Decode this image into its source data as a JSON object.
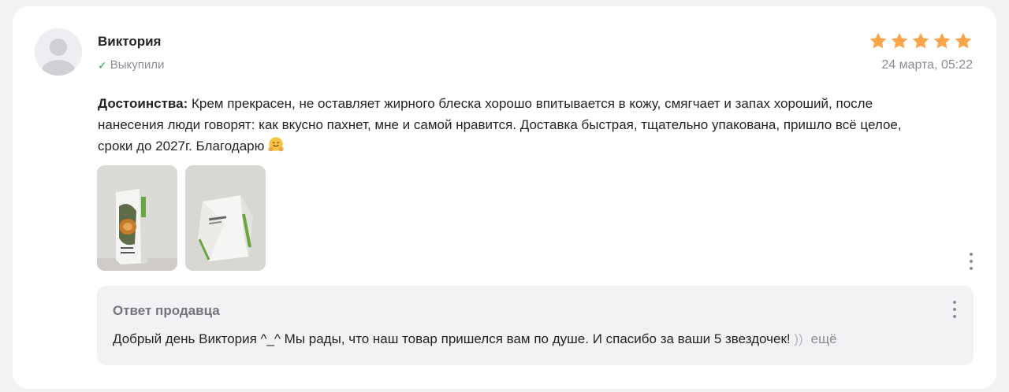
{
  "review": {
    "author": "Виктория",
    "verified_label": "Выкупили",
    "verified_icon": "check-icon",
    "rating": 5,
    "rating_max": 5,
    "star_color": "#f9a64a",
    "date": "24 марта, 05:22",
    "pros_label": "Достоинства:",
    "pros_text": " Крем прекрасен, не оставляет жирного блеска хорошо впитывается в кожу, смягчает и запах хороший, после нанесения люди говорят: как вкусно пахнет, мне и самой нравится. Доставка быстрая, тщательно упакована, пришло всё целое, сроки до 2027г. Благодарю",
    "emoji": "hugging-face-emoji",
    "photos": [
      "product-box-photo",
      "product-box-bottom-photo"
    ],
    "more_icon": "more-vertical-icon"
  },
  "seller_reply": {
    "title": "Ответ продавца",
    "text": "Добрый день Виктория ^_^ Мы рады, что наш товар пришелся вам по душе. И спасибо за ваши 5 звездочек! ",
    "text_faded": "))",
    "more_label": "ещё",
    "more_icon": "more-vertical-icon"
  }
}
